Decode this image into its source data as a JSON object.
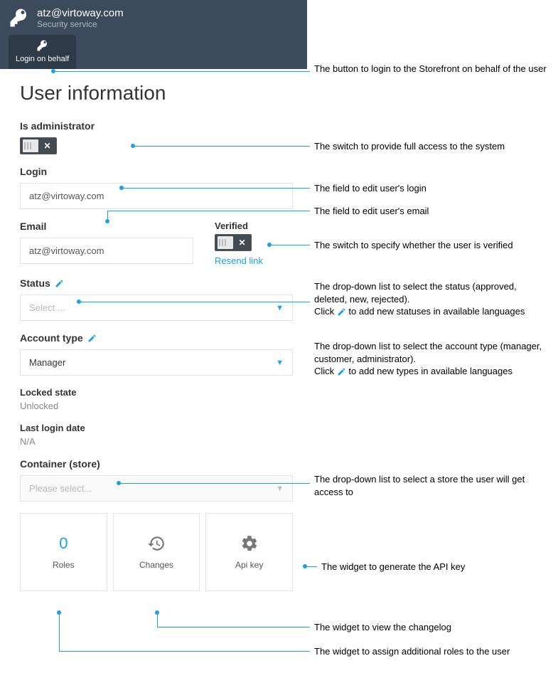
{
  "header": {
    "title": "atz@virtoway.com",
    "subtitle": "Security service",
    "tab_label": "Login on behalf"
  },
  "page_title": "User information",
  "labels": {
    "is_admin": "Is administrator",
    "login": "Login",
    "email": "Email",
    "verified": "Verified",
    "resend_link": "Resend link",
    "status": "Status",
    "account_type": "Account type",
    "locked_state": "Locked state",
    "last_login": "Last login date",
    "container": "Container (store)"
  },
  "values": {
    "login": "atz@virtoway.com",
    "email": "atz@virtoway.com",
    "status_placeholder": "Select ...",
    "account_type": "Manager",
    "locked_state": "Unlocked",
    "last_login": "N/A",
    "container_placeholder": "Please select..."
  },
  "widgets": {
    "roles_count": "0",
    "roles": "Roles",
    "changes": "Changes",
    "api_key": "Api key"
  },
  "annotations": {
    "login_behalf": "The button to login to the Storefront on behalf of the user",
    "admin_switch": "The switch to provide full access to the system",
    "login_field": "The field to edit user's login",
    "email_field": "The field to edit user's email",
    "verified_switch": "The switch to specify whether the user is verified",
    "status_a": "The drop-down list to select the status (approved, deleted, new, rejected).",
    "status_b1": "Click",
    "status_b2": "to add new statuses in available languages",
    "acct_a": "The drop-down list to select the account type (manager, customer, administrator).",
    "acct_b1": "Click",
    "acct_b2": "to add new types in available languages",
    "container": "The drop-down list to select a store the user will get access to",
    "apikey": "The widget to generate the API key",
    "changes": "The widget to view the changelog",
    "roles": "The widget to assign additional roles to the user"
  }
}
